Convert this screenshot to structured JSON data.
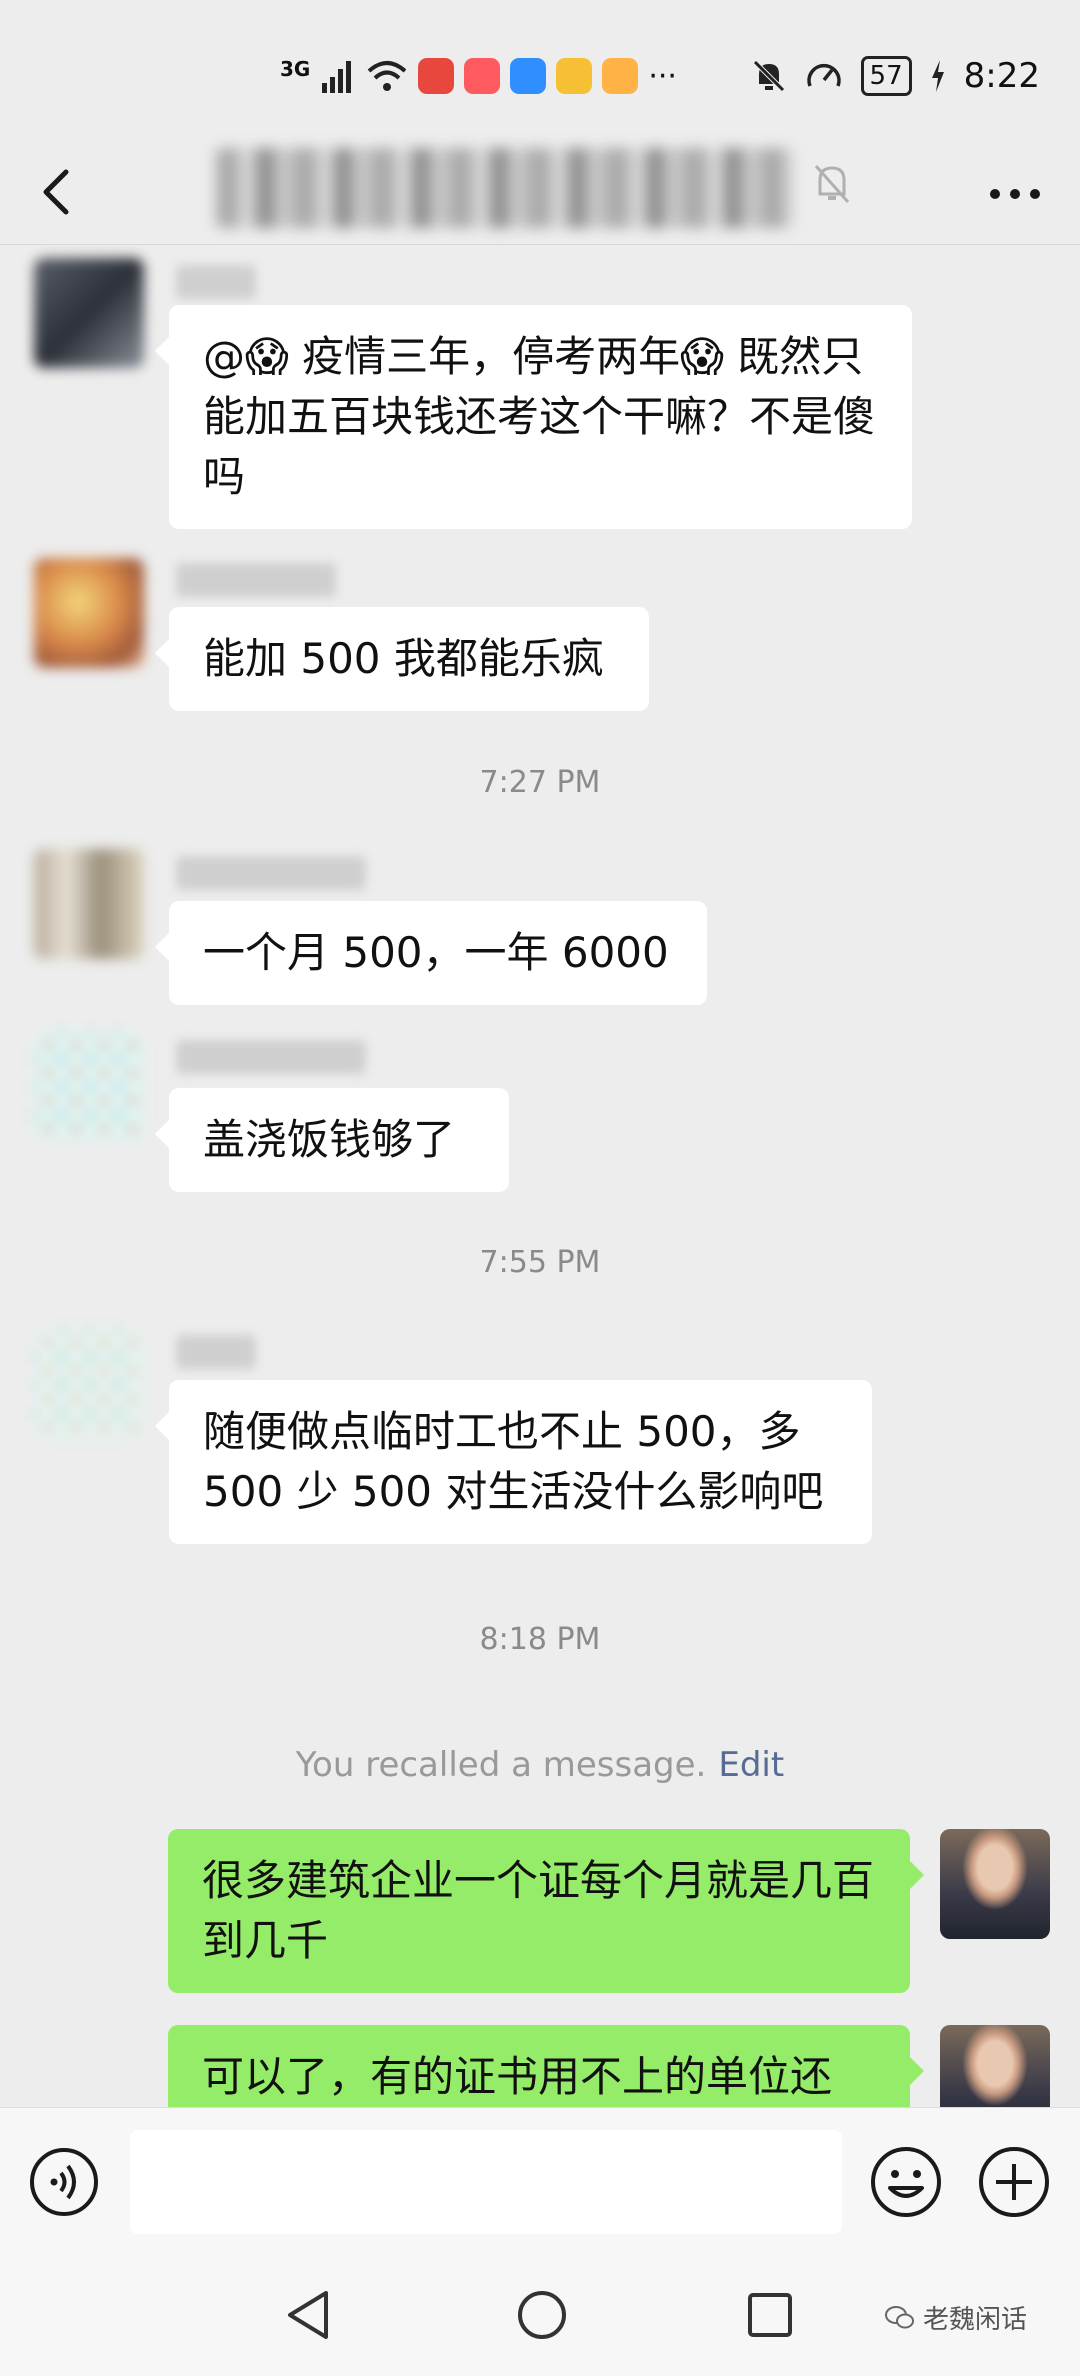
{
  "status_bar": {
    "network": "3G",
    "more_indicator": "···",
    "battery": "57",
    "time": "8:22"
  },
  "header": {
    "back_icon": "chevron-left-icon",
    "mute_icon": "bell-muted-icon",
    "more_icon": "ellipsis-icon"
  },
  "messages": [
    {
      "side": "left",
      "text": "@😱 疫情三年，停考两年😱 既然只能加五百块钱还考这个干嘛？不是傻吗"
    },
    {
      "side": "left",
      "text": "能加 500 我都能乐疯"
    },
    {
      "type": "time",
      "text": "7:27 PM"
    },
    {
      "side": "left",
      "text": "一个月 500，一年 6000"
    },
    {
      "side": "left",
      "text": "盖浇饭钱够了"
    },
    {
      "type": "time",
      "text": "7:55 PM"
    },
    {
      "side": "left",
      "text": "随便做点临时工也不止 500，多 500 少 500 对生活没什么影响吧"
    },
    {
      "type": "time",
      "text": "8:18 PM"
    },
    {
      "type": "recalled",
      "text": "You recalled a message.",
      "action": "Edit"
    },
    {
      "side": "right",
      "text": "很多建筑企业一个证每个月就是几百到几千"
    },
    {
      "side": "right",
      "text": "可以了，有的证书用不上的单位还"
    }
  ],
  "input_bar": {
    "voice_icon": "voice-icon",
    "emoji_icon": "emoji-icon",
    "plus_icon": "plus-icon",
    "placeholder": ""
  },
  "watermark": "老魏闲话",
  "colors": {
    "background": "#ededed",
    "bubble_self": "#95ec69",
    "bubble_other": "#ffffff",
    "link": "#576b95"
  }
}
